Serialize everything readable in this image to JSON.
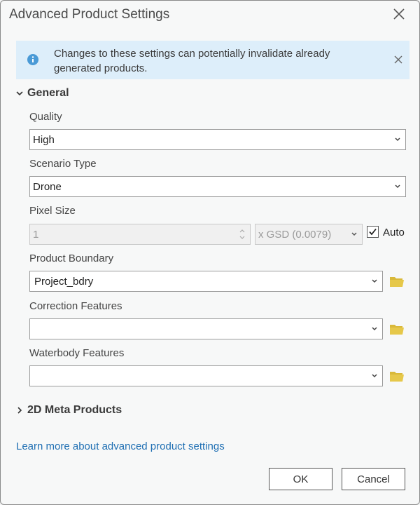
{
  "dialog": {
    "title": "Advanced Product Settings"
  },
  "banner": {
    "message": "Changes to these settings can potentially invalidate already generated products.",
    "icon": "info-icon",
    "color": "#4a9ad6"
  },
  "general": {
    "header": "General",
    "expanded": true,
    "quality": {
      "label": "Quality",
      "value": "High"
    },
    "scenario_type": {
      "label": "Scenario Type",
      "value": "Drone"
    },
    "pixel_size": {
      "label": "Pixel Size",
      "value": "1",
      "unit": "x GSD (0.0079)",
      "auto_label": "Auto",
      "auto_checked": true
    },
    "product_boundary": {
      "label": "Product Boundary",
      "value": "Project_bdry"
    },
    "correction_features": {
      "label": "Correction Features",
      "value": ""
    },
    "waterbody_features": {
      "label": "Waterbody Features",
      "value": ""
    }
  },
  "meta_products": {
    "header": "2D Meta Products",
    "expanded": false
  },
  "learn_more_link": "Learn more about advanced product settings",
  "buttons": {
    "ok": "OK",
    "cancel": "Cancel"
  },
  "colors": {
    "folder": "#e6c84a",
    "link": "#1f6fb3",
    "banner_bg": "#ddeefa"
  }
}
